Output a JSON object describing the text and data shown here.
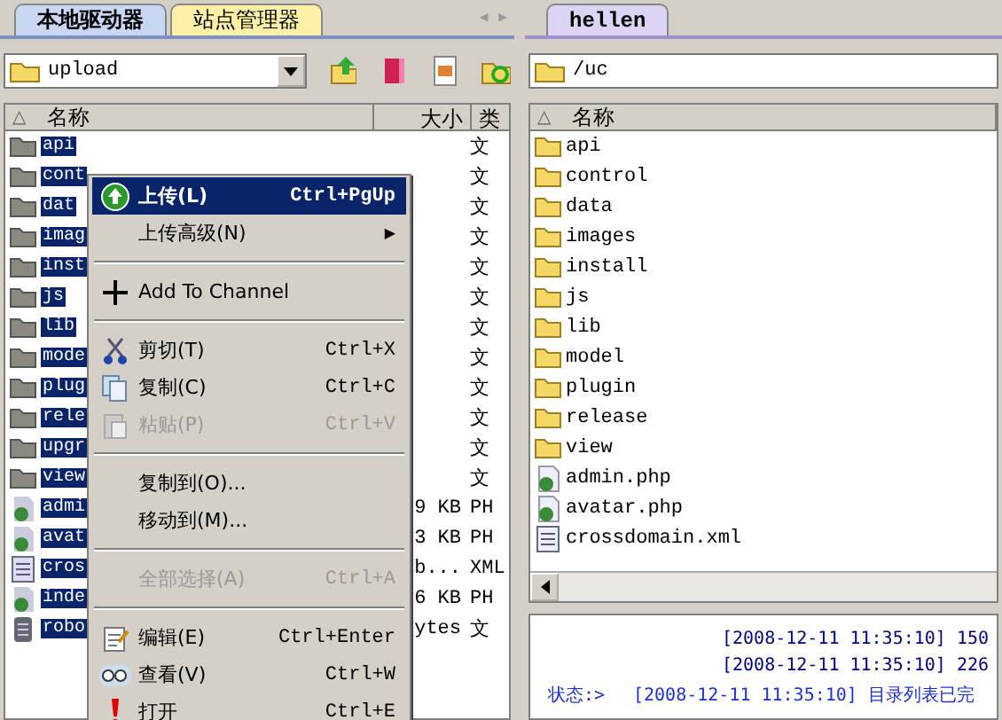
{
  "left_pane": {
    "tabs": [
      {
        "label": "本地驱动器",
        "selected": true
      },
      {
        "label": "站点管理器",
        "selected": false
      }
    ],
    "tab_scroll": [
      "◀",
      "▶"
    ],
    "path": "upload",
    "sort_arrow": "△",
    "columns": [
      "名称",
      "大小",
      "类"
    ],
    "rows": [
      {
        "name": "api",
        "size": "",
        "type": "文",
        "kind": "folder",
        "selected": true
      },
      {
        "name": "cont",
        "size": "",
        "type": "文",
        "kind": "folder",
        "selected": true
      },
      {
        "name": "dat",
        "size": "",
        "type": "文",
        "kind": "folder",
        "selected": true
      },
      {
        "name": "imag",
        "size": "",
        "type": "文",
        "kind": "folder",
        "selected": true
      },
      {
        "name": "inst",
        "size": "",
        "type": "文",
        "kind": "folder",
        "selected": true
      },
      {
        "name": "js",
        "size": "",
        "type": "文",
        "kind": "folder",
        "selected": true
      },
      {
        "name": "lib",
        "size": "",
        "type": "文",
        "kind": "folder",
        "selected": true
      },
      {
        "name": "mode",
        "size": "",
        "type": "文",
        "kind": "folder",
        "selected": true
      },
      {
        "name": "plug",
        "size": "",
        "type": "文",
        "kind": "folder",
        "selected": true
      },
      {
        "name": "rele",
        "size": "",
        "type": "文",
        "kind": "folder",
        "selected": true
      },
      {
        "name": "upgr",
        "size": "",
        "type": "文",
        "kind": "folder",
        "selected": true
      },
      {
        "name": "view",
        "size": "",
        "type": "文",
        "kind": "folder",
        "selected": true
      },
      {
        "name": "admi",
        "size": "9 KB",
        "type": "PH",
        "kind": "php",
        "selected": true
      },
      {
        "name": "avat",
        "size": "3 KB",
        "type": "PH",
        "kind": "php",
        "selected": true
      },
      {
        "name": "cros",
        "size": "b...",
        "type": "XML",
        "kind": "xml",
        "selected": true
      },
      {
        "name": "inde",
        "size": "6 KB",
        "type": "PH",
        "kind": "php",
        "selected": true
      },
      {
        "name": "robo",
        "size": "ytes",
        "type": "文",
        "kind": "txt",
        "selected": true
      }
    ]
  },
  "context_menu": [
    {
      "kind": "item",
      "label": "上传(L)",
      "shortcut": "Ctrl+PgUp",
      "highlighted": true,
      "disabled": false
    },
    {
      "kind": "submenu",
      "label": "上传高级(N)",
      "arrow": "▶",
      "highlighted": false,
      "disabled": false
    },
    {
      "kind": "separator"
    },
    {
      "kind": "item",
      "label": "Add To Channel",
      "highlighted": false,
      "disabled": false
    },
    {
      "kind": "separator"
    },
    {
      "kind": "item",
      "label": "剪切(T)",
      "shortcut": "Ctrl+X",
      "highlighted": false,
      "disabled": false
    },
    {
      "kind": "item",
      "label": "复制(C)",
      "shortcut": "Ctrl+C",
      "highlighted": false,
      "disabled": false
    },
    {
      "kind": "item",
      "label": "粘贴(P)",
      "shortcut": "Ctrl+V",
      "highlighted": false,
      "disabled": true
    },
    {
      "kind": "separator"
    },
    {
      "kind": "item",
      "label": "复制到(O)...",
      "highlighted": false,
      "disabled": false
    },
    {
      "kind": "item",
      "label": "移动到(M)...",
      "highlighted": false,
      "disabled": false
    },
    {
      "kind": "separator"
    },
    {
      "kind": "item",
      "label": "全部选择(A)",
      "shortcut": "Ctrl+A",
      "highlighted": false,
      "disabled": true
    },
    {
      "kind": "separator"
    },
    {
      "kind": "item",
      "label": "编辑(E)",
      "shortcut": "Ctrl+Enter",
      "highlighted": false,
      "disabled": false
    },
    {
      "kind": "item",
      "label": "查看(V)",
      "shortcut": "Ctrl+W",
      "highlighted": false,
      "disabled": false
    },
    {
      "kind": "item",
      "label": "打开",
      "shortcut": "Ctrl+E",
      "highlighted": false,
      "disabled": false
    }
  ],
  "right_pane": {
    "tabs": [
      {
        "label": "hellen",
        "selected": true
      }
    ],
    "path": "/uc",
    "sort_arrow": "△",
    "columns": [
      "名称"
    ],
    "rows": [
      {
        "name": "api",
        "kind": "folder"
      },
      {
        "name": "control",
        "kind": "folder"
      },
      {
        "name": "data",
        "kind": "folder"
      },
      {
        "name": "images",
        "kind": "folder"
      },
      {
        "name": "install",
        "kind": "folder"
      },
      {
        "name": "js",
        "kind": "folder"
      },
      {
        "name": "lib",
        "kind": "folder"
      },
      {
        "name": "model",
        "kind": "folder"
      },
      {
        "name": "plugin",
        "kind": "folder"
      },
      {
        "name": "release",
        "kind": "folder"
      },
      {
        "name": "view",
        "kind": "folder"
      },
      {
        "name": "admin.php",
        "kind": "php"
      },
      {
        "name": "avatar.php",
        "kind": "php"
      },
      {
        "name": "crossdomain.xml",
        "kind": "xml"
      }
    ]
  },
  "log": [
    {
      "kind": "plain",
      "text": "[2008-12-11 11:35:10] 150"
    },
    {
      "kind": "plain",
      "text": "[2008-12-11 11:35:10] 226"
    },
    {
      "kind": "status",
      "label": "状态:>",
      "text": "[2008-12-11 11:35:10] 目录列表已完"
    }
  ]
}
